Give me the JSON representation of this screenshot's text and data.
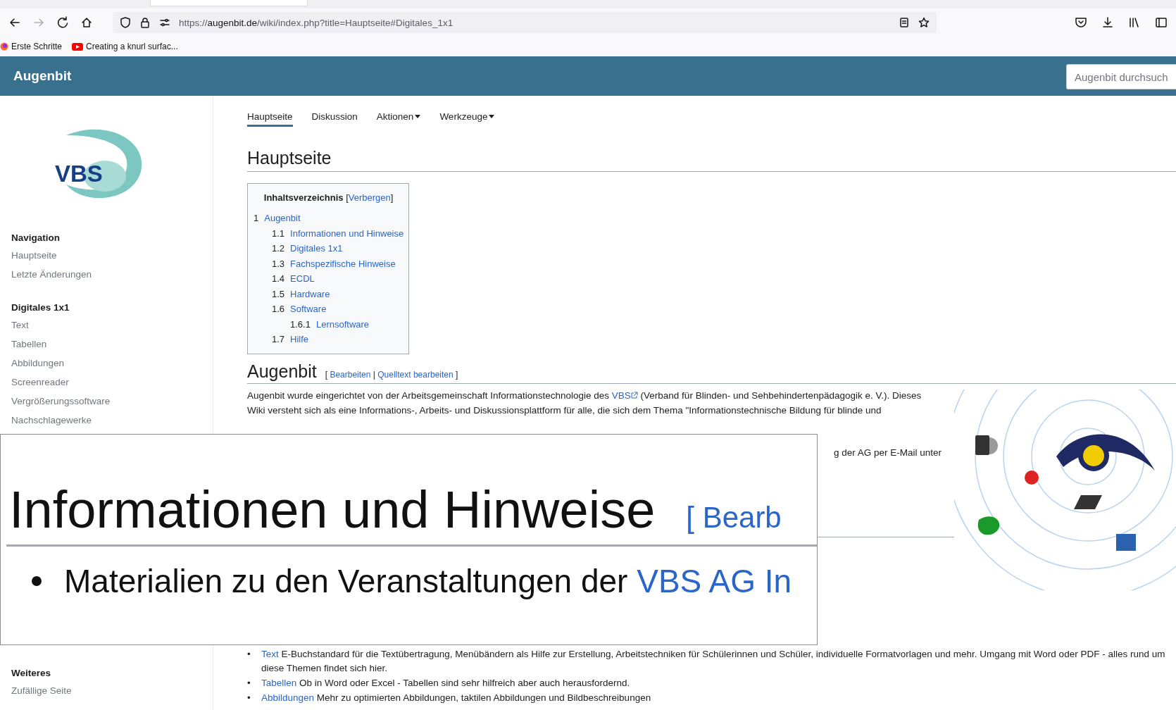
{
  "browser": {
    "url_scheme": "https://",
    "url_host": "augenbit.de",
    "url_path": "/wiki/index.php?title=Hauptseite#Digitales_1x1",
    "forward_disabled": true,
    "bookmarks": [
      {
        "label": "Erste Schritte",
        "kind": "firefox"
      },
      {
        "label": "Creating a knurl surfac...",
        "kind": "youtube"
      }
    ]
  },
  "header": {
    "site_name": "Augenbit",
    "search_placeholder": "Augenbit durchsuch"
  },
  "sidebar": {
    "logo_text": "VBS",
    "sections": [
      {
        "heading": "Navigation",
        "items": [
          "Hauptseite",
          "Letzte Änderungen"
        ]
      },
      {
        "heading": "Digitales 1x1",
        "items": [
          "Text",
          "Tabellen",
          "Abbildungen",
          "Screenreader",
          "Vergrößerungssoftware",
          "Nachschlagewerke"
        ]
      },
      {
        "heading": "Weiteres",
        "items": [
          "Zufällige Seite"
        ]
      }
    ]
  },
  "tabs": [
    {
      "label": "Hauptseite",
      "selected": true,
      "dropdown": false
    },
    {
      "label": "Diskussion",
      "selected": false,
      "dropdown": false
    },
    {
      "label": "Aktionen",
      "selected": false,
      "dropdown": true
    },
    {
      "label": "Werkzeuge",
      "selected": false,
      "dropdown": true
    }
  ],
  "page_title": "Hauptseite",
  "toc": {
    "title": "Inhaltsverzeichnis",
    "toggle_open": "[",
    "toggle": "Verbergen",
    "toggle_close": "]",
    "items": [
      {
        "number": "1",
        "label": "Augenbit",
        "children": [
          {
            "number": "1.1",
            "label": "Informationen und Hinweise"
          },
          {
            "number": "1.2",
            "label": "Digitales 1x1"
          },
          {
            "number": "1.3",
            "label": "Fachspezifische Hinweise"
          },
          {
            "number": "1.4",
            "label": "ECDL"
          },
          {
            "number": "1.5",
            "label": "Hardware"
          },
          {
            "number": "1.6",
            "label": "Software",
            "children": [
              {
                "number": "1.6.1",
                "label": "Lernsoftware"
              }
            ]
          },
          {
            "number": "1.7",
            "label": "Hilfe"
          }
        ]
      }
    ]
  },
  "section": {
    "heading": "Augenbit",
    "edit_open": "[",
    "edit_links": [
      "Bearbeiten",
      "Quelltext bearbeiten"
    ],
    "edit_separator": "|",
    "edit_close": "]",
    "bullet_marker": "•",
    "intro_before": "Augenbit wurde eingerichtet von der Arbeitsgemeinschaft Informationstechnologie des ",
    "intro_link": "VBS",
    "intro_after": " (Verband für Blinden- und Sehbehindertenpädagogik e. V.). Dieses",
    "intro_line2": "Wiki versteht sich als eine Informations-, Arbeits- und Diskussionsplattform für alle, die sich dem Thema \"Informationstechnische Bildung für blinde und",
    "intro_fragment": "g der AG per E-Mail unter",
    "bullets": [
      {
        "link": "Text",
        "text": " E-Buchstandard für die Textübertragung, Menübändern als Hilfe zur Erstellung, Arbeitstechniken für Schülerinnen und Schüler, individuelle Formatvorlagen und mehr. Umgang mit Word oder PDF - alles rund um diese Themen findet sich hier."
      },
      {
        "link": "Tabellen",
        "text": " Ob in Word oder Excel - Tabellen sind sehr hilfreich aber auch herausfordernd."
      },
      {
        "link": "Abbildungen",
        "text": " Mehr zu optimierten Abbildungen, taktilen Abbildungen und Bildbeschreibungen"
      }
    ]
  },
  "magnifier": {
    "heading": "Informationen und Hinweise",
    "edit_fragment": "[ Bearb",
    "bullet_text": "Materialien zu den Veranstaltungen der ",
    "bullet_link": "VBS AG In"
  }
}
